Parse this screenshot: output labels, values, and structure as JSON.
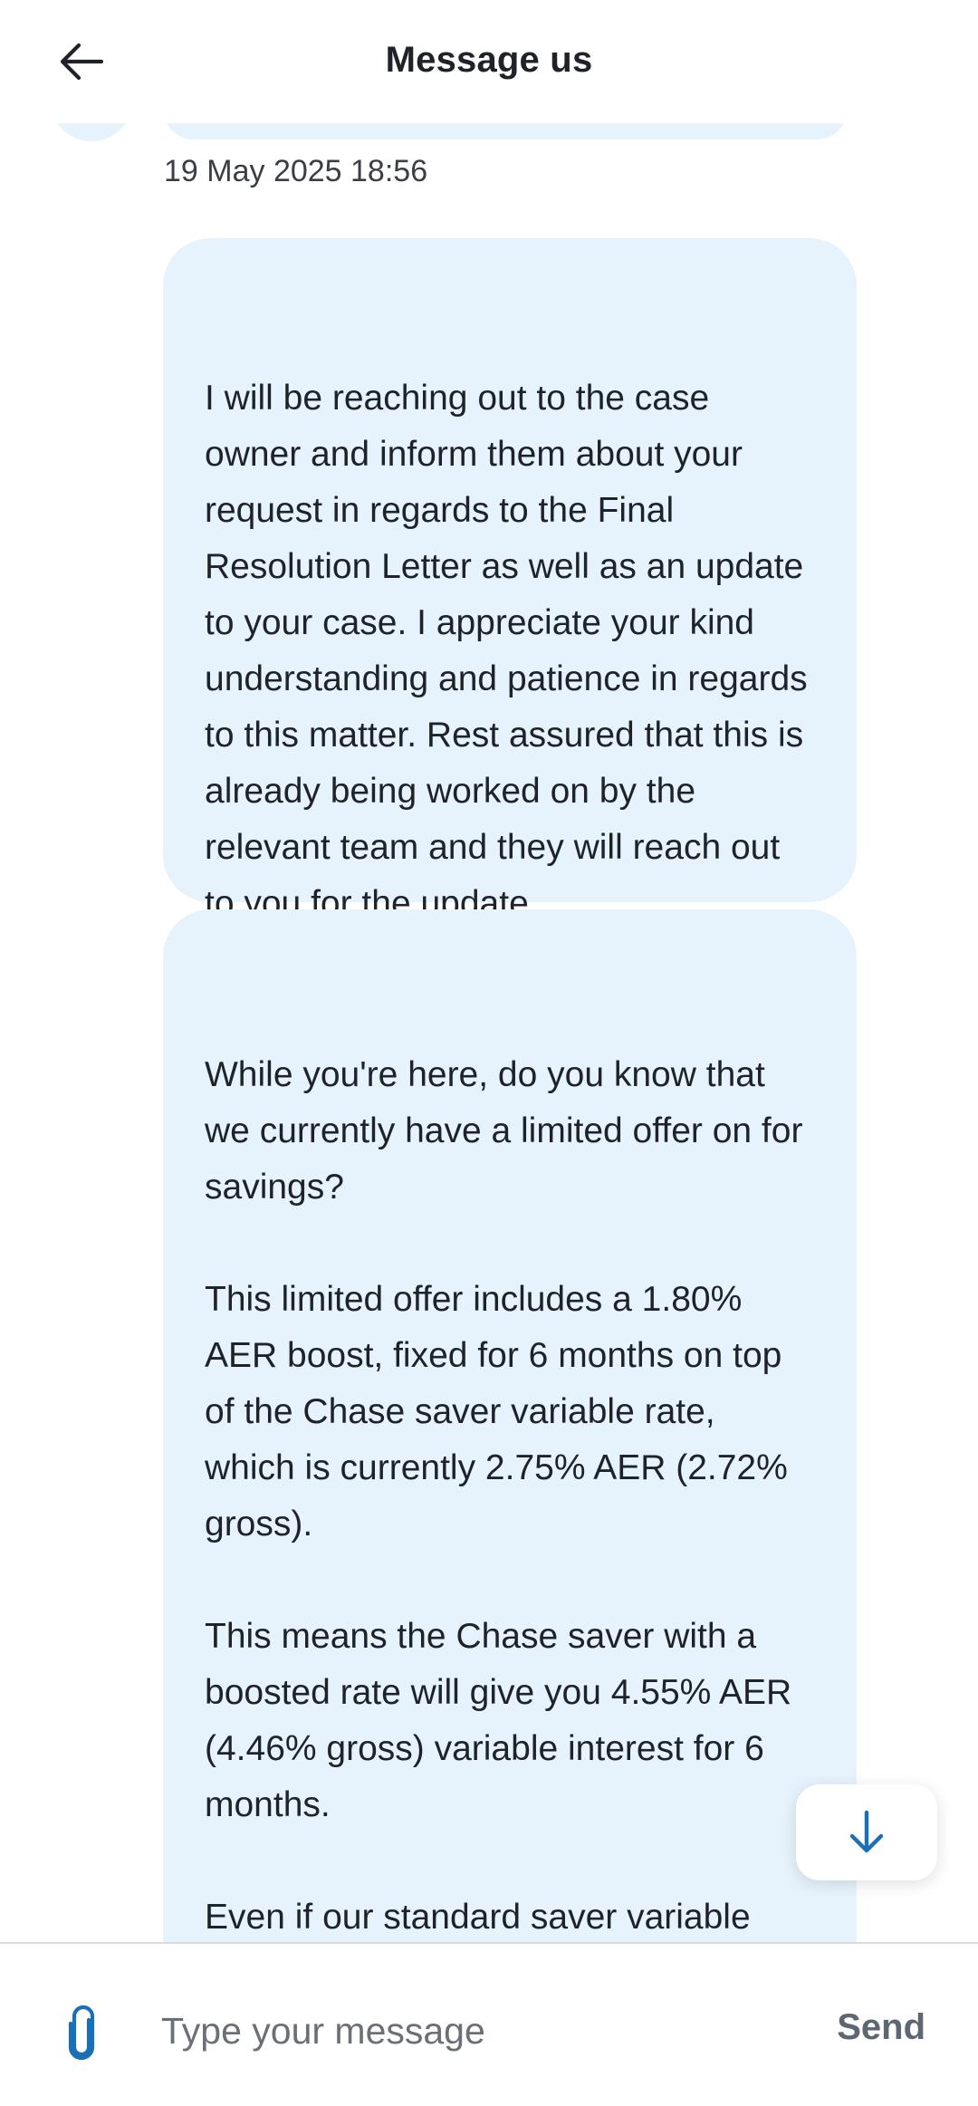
{
  "header": {
    "title": "Message us",
    "back_icon": "arrow-left-icon"
  },
  "conversation": {
    "timestamp": "19 May 2025 18:56",
    "messages": [
      {
        "text": "I will be reaching out to the case owner and inform them about your request in regards to the Final Resolution Letter as well as an update to your case. I appreciate your kind understanding and patience in regards to this matter. Rest assured that this is already being worked on by the relevant team and they will reach out to you for the update."
      },
      {
        "text": "While you're here, do you know that we currently have a limited offer on for savings?\n\nThis limited offer includes a 1.80% AER boost, fixed for 6 months on top of the Chase saver variable rate, which is currently 2.75% AER (2.72% gross).\n\nThis means the Chase saver with a boosted rate will give you 4.55% AER (4.46% gross) variable interest for 6 months.\n\nEven if our standard saver variable rate changes between now and when your boost ends, you'll keep"
      }
    ],
    "bubble_color": "#e6f3fd"
  },
  "scroll_button": {
    "icon": "arrow-down-icon",
    "icon_color": "#1a6fb5"
  },
  "composer": {
    "attach_icon": "paperclip-icon",
    "attach_icon_color": "#1a6fb5",
    "placeholder": "Type your message",
    "value": "",
    "send_label": "Send"
  }
}
